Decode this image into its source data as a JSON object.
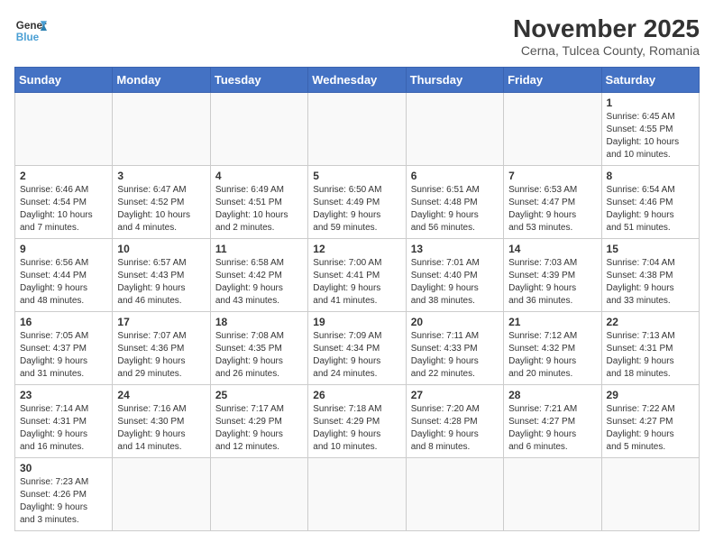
{
  "header": {
    "logo_general": "General",
    "logo_blue": "Blue",
    "month_title": "November 2025",
    "subtitle": "Cerna, Tulcea County, Romania"
  },
  "days_of_week": [
    "Sunday",
    "Monday",
    "Tuesday",
    "Wednesday",
    "Thursday",
    "Friday",
    "Saturday"
  ],
  "weeks": [
    [
      {
        "day": "",
        "info": ""
      },
      {
        "day": "",
        "info": ""
      },
      {
        "day": "",
        "info": ""
      },
      {
        "day": "",
        "info": ""
      },
      {
        "day": "",
        "info": ""
      },
      {
        "day": "",
        "info": ""
      },
      {
        "day": "1",
        "info": "Sunrise: 6:45 AM\nSunset: 4:55 PM\nDaylight: 10 hours\nand 10 minutes."
      }
    ],
    [
      {
        "day": "2",
        "info": "Sunrise: 6:46 AM\nSunset: 4:54 PM\nDaylight: 10 hours\nand 7 minutes."
      },
      {
        "day": "3",
        "info": "Sunrise: 6:47 AM\nSunset: 4:52 PM\nDaylight: 10 hours\nand 4 minutes."
      },
      {
        "day": "4",
        "info": "Sunrise: 6:49 AM\nSunset: 4:51 PM\nDaylight: 10 hours\nand 2 minutes."
      },
      {
        "day": "5",
        "info": "Sunrise: 6:50 AM\nSunset: 4:49 PM\nDaylight: 9 hours\nand 59 minutes."
      },
      {
        "day": "6",
        "info": "Sunrise: 6:51 AM\nSunset: 4:48 PM\nDaylight: 9 hours\nand 56 minutes."
      },
      {
        "day": "7",
        "info": "Sunrise: 6:53 AM\nSunset: 4:47 PM\nDaylight: 9 hours\nand 53 minutes."
      },
      {
        "day": "8",
        "info": "Sunrise: 6:54 AM\nSunset: 4:46 PM\nDaylight: 9 hours\nand 51 minutes."
      }
    ],
    [
      {
        "day": "9",
        "info": "Sunrise: 6:56 AM\nSunset: 4:44 PM\nDaylight: 9 hours\nand 48 minutes."
      },
      {
        "day": "10",
        "info": "Sunrise: 6:57 AM\nSunset: 4:43 PM\nDaylight: 9 hours\nand 46 minutes."
      },
      {
        "day": "11",
        "info": "Sunrise: 6:58 AM\nSunset: 4:42 PM\nDaylight: 9 hours\nand 43 minutes."
      },
      {
        "day": "12",
        "info": "Sunrise: 7:00 AM\nSunset: 4:41 PM\nDaylight: 9 hours\nand 41 minutes."
      },
      {
        "day": "13",
        "info": "Sunrise: 7:01 AM\nSunset: 4:40 PM\nDaylight: 9 hours\nand 38 minutes."
      },
      {
        "day": "14",
        "info": "Sunrise: 7:03 AM\nSunset: 4:39 PM\nDaylight: 9 hours\nand 36 minutes."
      },
      {
        "day": "15",
        "info": "Sunrise: 7:04 AM\nSunset: 4:38 PM\nDaylight: 9 hours\nand 33 minutes."
      }
    ],
    [
      {
        "day": "16",
        "info": "Sunrise: 7:05 AM\nSunset: 4:37 PM\nDaylight: 9 hours\nand 31 minutes."
      },
      {
        "day": "17",
        "info": "Sunrise: 7:07 AM\nSunset: 4:36 PM\nDaylight: 9 hours\nand 29 minutes."
      },
      {
        "day": "18",
        "info": "Sunrise: 7:08 AM\nSunset: 4:35 PM\nDaylight: 9 hours\nand 26 minutes."
      },
      {
        "day": "19",
        "info": "Sunrise: 7:09 AM\nSunset: 4:34 PM\nDaylight: 9 hours\nand 24 minutes."
      },
      {
        "day": "20",
        "info": "Sunrise: 7:11 AM\nSunset: 4:33 PM\nDaylight: 9 hours\nand 22 minutes."
      },
      {
        "day": "21",
        "info": "Sunrise: 7:12 AM\nSunset: 4:32 PM\nDaylight: 9 hours\nand 20 minutes."
      },
      {
        "day": "22",
        "info": "Sunrise: 7:13 AM\nSunset: 4:31 PM\nDaylight: 9 hours\nand 18 minutes."
      }
    ],
    [
      {
        "day": "23",
        "info": "Sunrise: 7:14 AM\nSunset: 4:31 PM\nDaylight: 9 hours\nand 16 minutes."
      },
      {
        "day": "24",
        "info": "Sunrise: 7:16 AM\nSunset: 4:30 PM\nDaylight: 9 hours\nand 14 minutes."
      },
      {
        "day": "25",
        "info": "Sunrise: 7:17 AM\nSunset: 4:29 PM\nDaylight: 9 hours\nand 12 minutes."
      },
      {
        "day": "26",
        "info": "Sunrise: 7:18 AM\nSunset: 4:29 PM\nDaylight: 9 hours\nand 10 minutes."
      },
      {
        "day": "27",
        "info": "Sunrise: 7:20 AM\nSunset: 4:28 PM\nDaylight: 9 hours\nand 8 minutes."
      },
      {
        "day": "28",
        "info": "Sunrise: 7:21 AM\nSunset: 4:27 PM\nDaylight: 9 hours\nand 6 minutes."
      },
      {
        "day": "29",
        "info": "Sunrise: 7:22 AM\nSunset: 4:27 PM\nDaylight: 9 hours\nand 5 minutes."
      }
    ],
    [
      {
        "day": "30",
        "info": "Sunrise: 7:23 AM\nSunset: 4:26 PM\nDaylight: 9 hours\nand 3 minutes."
      },
      {
        "day": "",
        "info": ""
      },
      {
        "day": "",
        "info": ""
      },
      {
        "day": "",
        "info": ""
      },
      {
        "day": "",
        "info": ""
      },
      {
        "day": "",
        "info": ""
      },
      {
        "day": "",
        "info": ""
      }
    ]
  ]
}
